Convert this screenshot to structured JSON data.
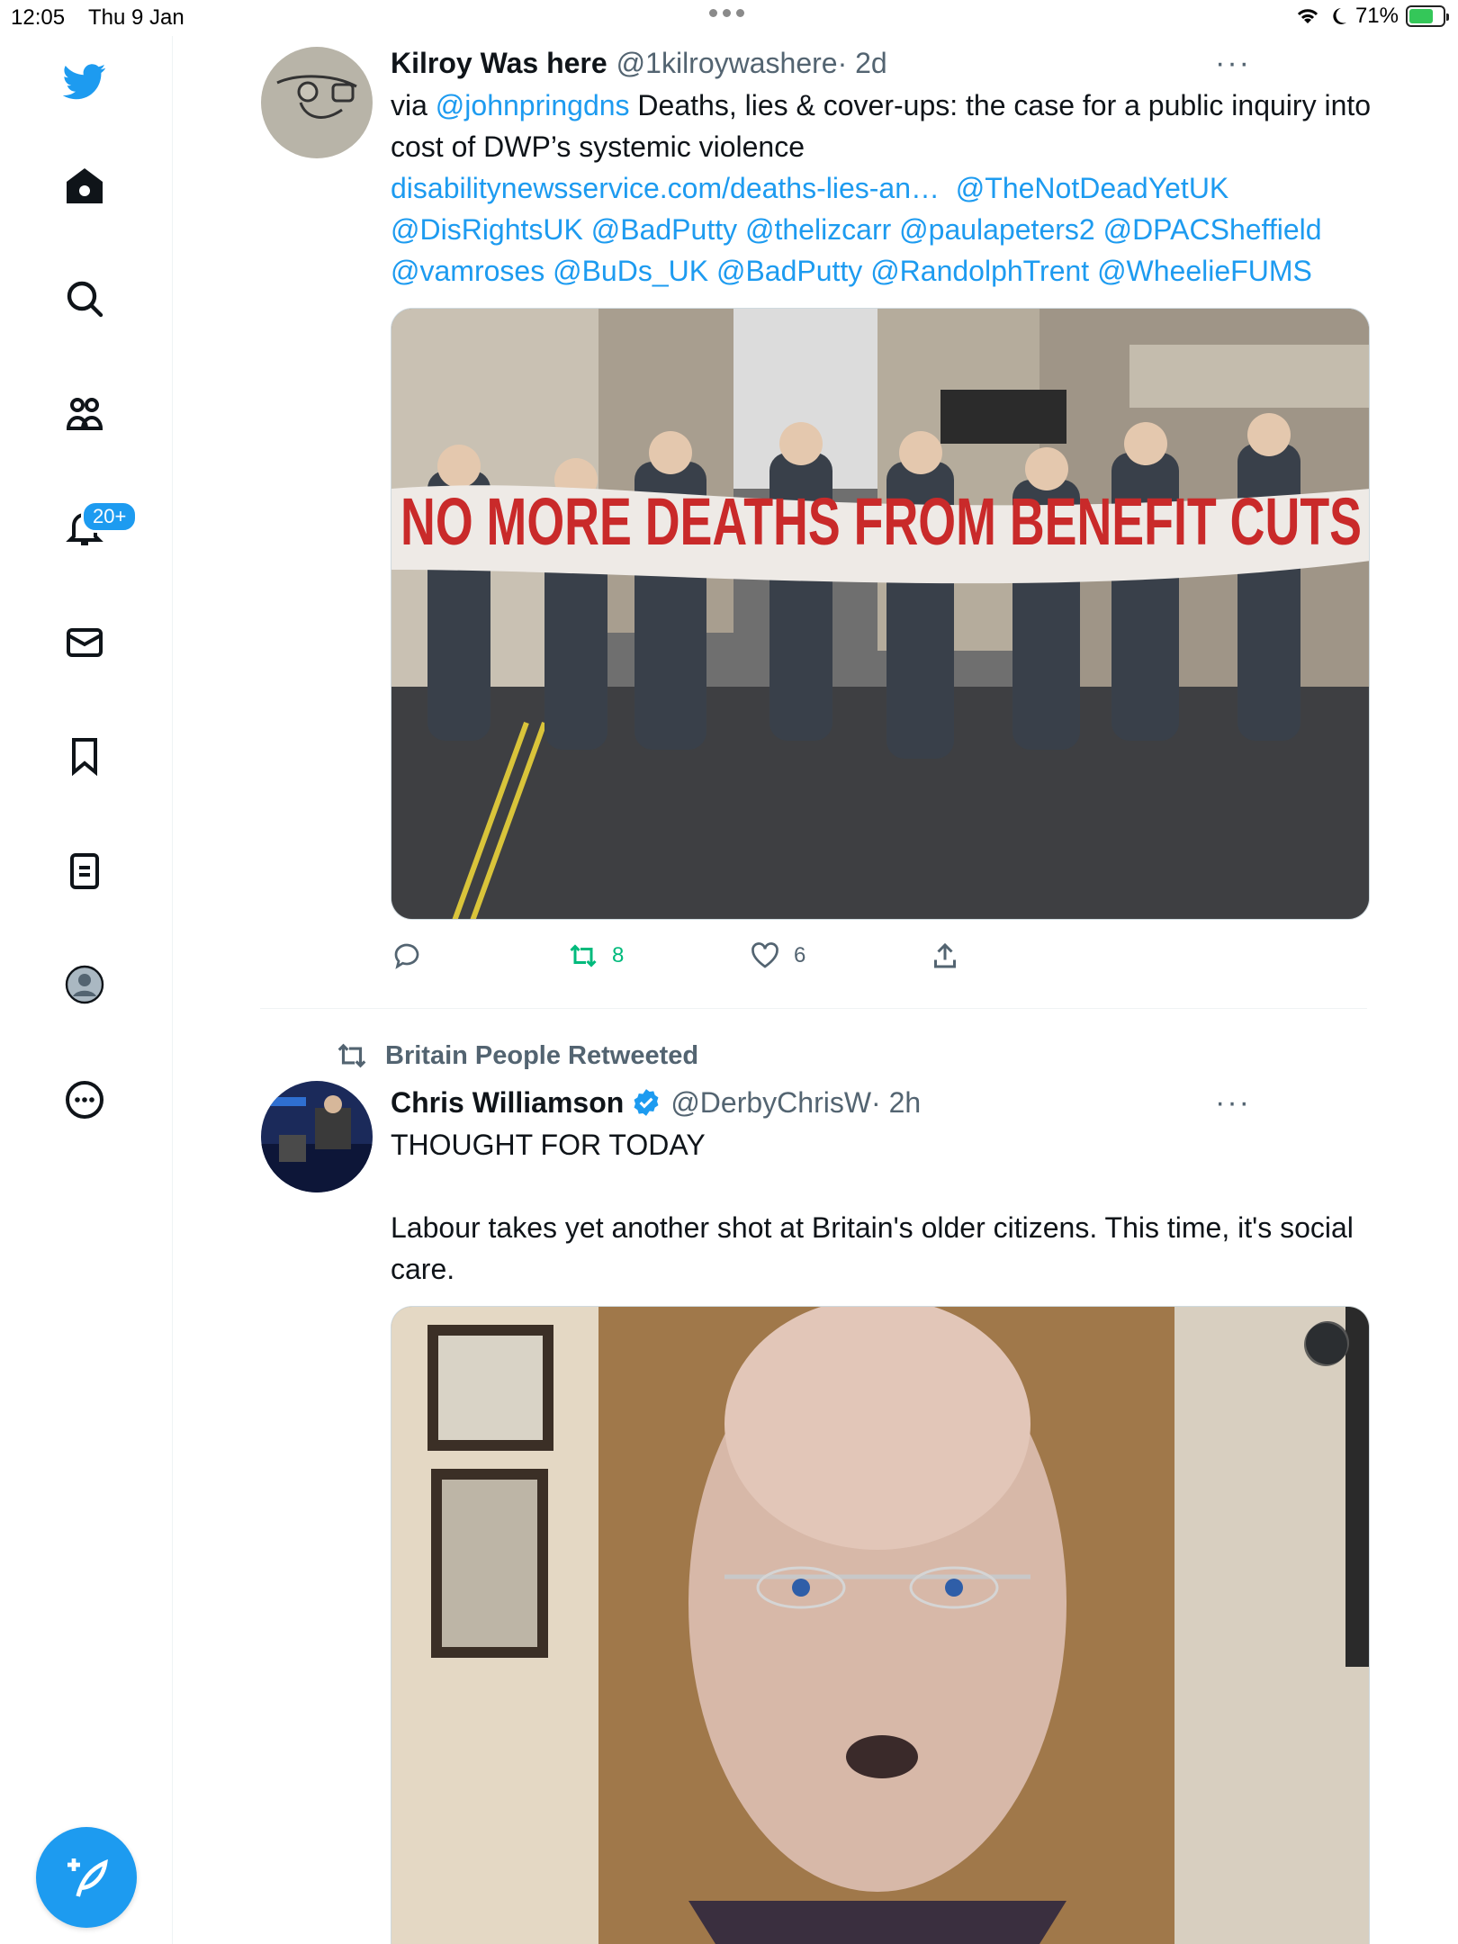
{
  "status_bar": {
    "time": "12:05",
    "date": "Thu 9 Jan",
    "battery": "71%",
    "battery_level": 0.71
  },
  "sidebar": {
    "items": [
      "twitter-logo",
      "home",
      "explore",
      "communities",
      "notifications",
      "messages",
      "bookmarks",
      "lists",
      "profile",
      "more"
    ],
    "notifications_badge": "20+"
  },
  "colors": {
    "accent": "#1d9bf0",
    "retweet": "#00ba7c",
    "text_secondary": "#536471"
  },
  "tweets": [
    {
      "name": "Kilroy Was here",
      "handle": "@1kilroywashere",
      "time": " · 2d",
      "more": "···",
      "text_prefix": "via ",
      "mention1": "@johnpringdns",
      "text_main": " Deaths, lies & cover-ups: the case for a public inquiry into cost of DWP’s systemic violence",
      "link": "disabilitynewsservice.com/deaths-lies-an…",
      "mentions": "@TheNotDeadYetUK @DisRightsUK @BadPutty @thelizcarr @paulapeters2 @DPACSheffield @vamroses @BuDs_UK @BadPutty @RandolphTrent @WheelieFUMS",
      "banner_text": "NO MORE DEATHS FROM BENEFIT CUTS",
      "retweets": "8",
      "likes": "6"
    },
    {
      "retweeted_by": "Britain People Retweeted",
      "name": "Chris Williamson",
      "handle": "@DerbyChrisW",
      "time": " · 2h",
      "more": "···",
      "line1": "THOUGHT FOR TODAY",
      "line2": "Labour takes yet another shot at Britain's older citizens. This time, it's social care."
    }
  ]
}
